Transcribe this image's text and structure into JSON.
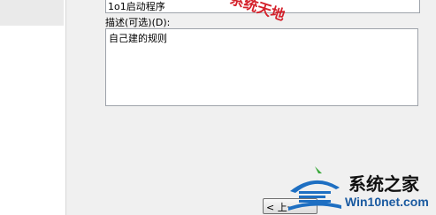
{
  "rule_name": {
    "value": "1o1启动程序"
  },
  "description": {
    "label": "描述(可选)(D):",
    "value": "自己建的规则"
  },
  "buttons": {
    "back": "< 上一"
  },
  "watermark": {
    "stamp_text": "系统天地",
    "title": "系统之家",
    "url": "Win10net.com"
  }
}
